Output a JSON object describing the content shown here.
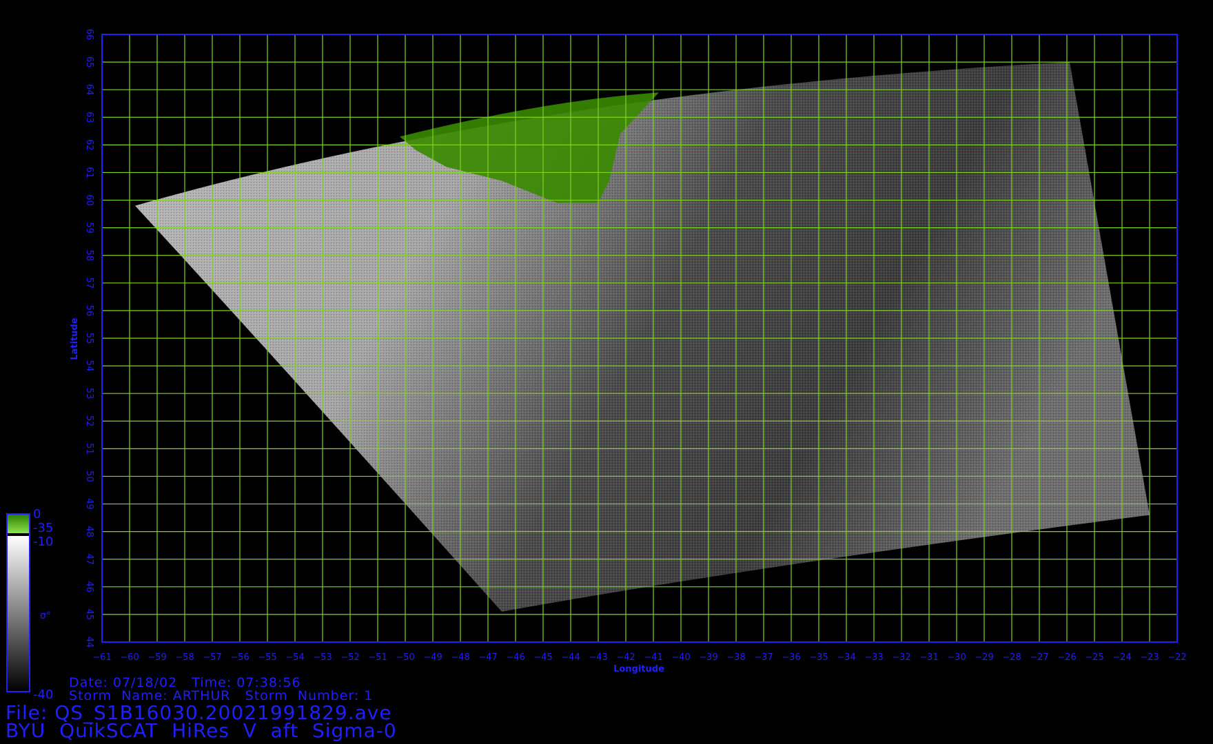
{
  "map": {
    "lon_min": -61,
    "lon_max": -22,
    "lat_min": 44,
    "lat_max": 66,
    "lon_ticks": [
      -61,
      -60,
      -59,
      -58,
      -57,
      -56,
      -55,
      -54,
      -53,
      -52,
      -51,
      -50,
      -49,
      -48,
      -47,
      -46,
      -45,
      -44,
      -43,
      -42,
      -41,
      -40,
      -39,
      -38,
      -37,
      -36,
      -35,
      -34,
      -33,
      -32,
      -31,
      -30,
      -29,
      -28,
      -27,
      -26,
      -25,
      -24,
      -23,
      -22
    ],
    "lat_ticks": [
      44,
      45,
      46,
      47,
      48,
      49,
      50,
      51,
      52,
      53,
      54,
      55,
      56,
      57,
      58,
      59,
      60,
      61,
      62,
      63,
      64,
      65,
      66
    ],
    "xlabel": "Longitude",
    "ylabel": "Latitude",
    "grid_color": "#7fd321",
    "axis_color": "#1f1fff",
    "land_color": "#3a8a00",
    "swath_corners": [
      [
        -59.8,
        59.8
      ],
      [
        -25.9,
        65.0
      ],
      [
        -23.0,
        48.6
      ],
      [
        -46.5,
        45.1
      ]
    ]
  },
  "colorbar": {
    "max_label": "0",
    "split_label": "-35",
    "upper_label": "-10",
    "min_label": "-40",
    "symbol": "σ°"
  },
  "info": {
    "date_line": "Date: 07/18/02   Time: 07:38:56",
    "storm_line": "Storm  Name: ARTHUR   Storm  Number: 1",
    "file_line": "File: QS_S1B16030.20021991829.ave",
    "title_line": "BYU  QuikSCAT  HiRes  V  aft  Sigma-0"
  }
}
